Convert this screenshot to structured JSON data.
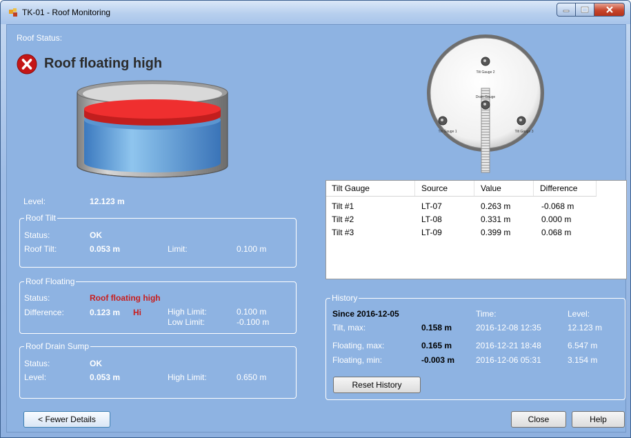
{
  "window": {
    "title": "TK-01 - Roof Monitoring"
  },
  "roof_status": {
    "label": "Roof Status:",
    "status_text": "Roof floating high"
  },
  "level": {
    "label": "Level:",
    "value": "12.123 m"
  },
  "roof_tilt": {
    "title": "Roof Tilt",
    "status_label": "Status:",
    "status_value": "OK",
    "tilt_label": "Roof Tilt:",
    "tilt_value": "0.053 m",
    "limit_label": "Limit:",
    "limit_value": "0.100 m"
  },
  "roof_floating": {
    "title": "Roof Floating",
    "status_label": "Status:",
    "status_value": "Roof floating high",
    "difference_label": "Difference:",
    "difference_value": "0.123 m",
    "hi_flag": "Hi",
    "high_limit_label": "High Limit:",
    "high_limit_value": "0.100 m",
    "low_limit_label": "Low Limit:",
    "low_limit_value": "-0.100 m"
  },
  "roof_drain": {
    "title": "Roof Drain Sump",
    "status_label": "Status:",
    "status_value": "OK",
    "level_label": "Level:",
    "level_value": "0.053 m",
    "high_limit_label": "High Limit:",
    "high_limit_value": "0.650 m"
  },
  "roof_diagram": {
    "gauge_top": "Tilt Gauge 2",
    "gauge_left": "Tilt Gauge 1",
    "gauge_right": "Tilt Gauge 3",
    "drain_gauge": "Drain Gauge"
  },
  "tilt_table": {
    "headers": [
      "Tilt Gauge",
      "Source",
      "Value",
      "Difference"
    ],
    "rows": [
      {
        "gauge": "Tilt #1",
        "source": "LT-07",
        "value": "0.263 m",
        "difference": "-0.068 m"
      },
      {
        "gauge": "Tilt #2",
        "source": "LT-08",
        "value": "0.331 m",
        "difference": "0.000 m"
      },
      {
        "gauge": "Tilt #3",
        "source": "LT-09",
        "value": "0.399 m",
        "difference": "0.068 m"
      }
    ]
  },
  "history": {
    "title": "History",
    "since": "Since 2016-12-05",
    "time_header": "Time:",
    "level_header": "Level:",
    "rows": [
      {
        "label": "Tilt, max:",
        "value": "0.158 m",
        "time": "2016-12-08 12:35",
        "level": "12.123 m"
      },
      {
        "label": "Floating, max:",
        "value": "0.165 m",
        "time": "2016-12-21 18:48",
        "level": "6.547 m"
      },
      {
        "label": "Floating, min:",
        "value": "-0.003 m",
        "time": "2016-12-06 05:31",
        "level": "3.154 m"
      }
    ],
    "reset_label": "Reset History"
  },
  "buttons": {
    "fewer_details": "< Fewer Details",
    "close": "Close",
    "help": "Help"
  },
  "colors": {
    "client_bg": "#8eb3e2",
    "alarm_red": "#c81e1e",
    "roof_red": "#e83030"
  }
}
